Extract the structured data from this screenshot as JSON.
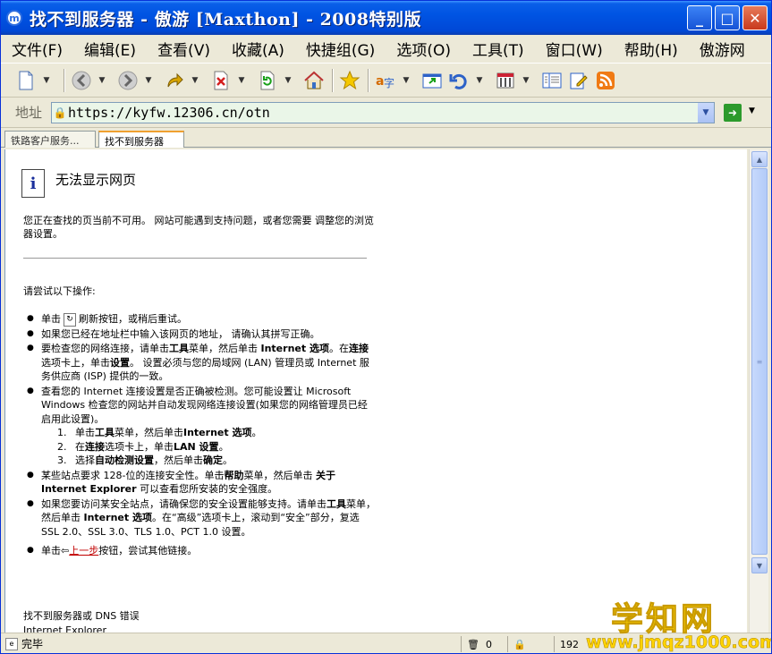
{
  "window": {
    "title": "找不到服务器 - 傲游 [Maxthon] - 2008特别版",
    "controls": {
      "minimize": "_",
      "maximize": "□",
      "close": "✕"
    }
  },
  "menu": [
    "文件(F)",
    "编辑(E)",
    "查看(V)",
    "收藏(A)",
    "快捷组(G)",
    "选项(O)",
    "工具(T)",
    "窗口(W)",
    "帮助(H)",
    "傲游网"
  ],
  "toolbar": {
    "icons": [
      "new-page-icon",
      "back-icon",
      "forward-icon",
      "up-icon",
      "stop-icon",
      "refresh-icon",
      "home-icon",
      "favorites-star-icon",
      "translate-icon",
      "window-icon",
      "undo-icon",
      "tools-icon",
      "sidebar-icon",
      "edit-icon",
      "rss-icon"
    ]
  },
  "address": {
    "label": "地址",
    "url": "https://kyfw.12306.cn/otn"
  },
  "tabs": [
    {
      "label": "铁路客户服务..."
    },
    {
      "label": "找不到服务器"
    }
  ],
  "page": {
    "heading": "无法显示网页",
    "description": "您正在查找的页当前不可用。 网站可能遇到支持问题，或者您需要 调整您的浏览器设置。",
    "try_label": "请尝试以下操作:",
    "step1_pre": "单击",
    "step1_post": "刷新按钮，或稍后重试。",
    "step2": "如果您已经在地址栏中输入该网页的地址， 请确认其拼写正确。",
    "step3": {
      "t1": "要检查您的网络连接，请单击",
      "b1": "工具",
      "t2": "菜单，然后单击 ",
      "b2": "Internet 选项",
      "t3": "。在",
      "b3": "连接",
      "t4": "选项卡上，单击",
      "b4": "设置",
      "t5": "。 设置必须与您的局域网 (LAN) 管理员或 Internet 服务供应商 (ISP) 提供的一致。"
    },
    "step4": "查看您的 Internet 连接设置是否正确被检测。您可能设置让 Microsoft Windows 检查您的网站并自动发现网络连接设置(如果您的网络管理员已经启用此设置)。",
    "sub1": {
      "n": "1.",
      "t1": "单击",
      "b1": "工具",
      "t2": "菜单，然后单击",
      "b2": "Internet 选项",
      "t3": "。"
    },
    "sub2": {
      "n": "2.",
      "t1": "在",
      "b1": "连接",
      "t2": "选项卡上，单击",
      "b2": "LAN 设置",
      "t3": "。"
    },
    "sub3": {
      "n": "3.",
      "t1": "选择",
      "b1": "自动检测设置",
      "t2": "，然后单击",
      "b2": "确定",
      "t3": "。"
    },
    "step5": {
      "t1": "某些站点要求 128-位的连接安全性。单击",
      "b1": "帮助",
      "t2": "菜单，然后单击 ",
      "b2": "关于 Internet Explorer",
      "t3": " 可以查看您所安装的安全强度。"
    },
    "step6": {
      "t1": "如果您要访问某安全站点，请确保您的安全设置能够支持。请单击",
      "b1": "工具",
      "t2": "菜单，然后单击 ",
      "b2": "Internet 选项",
      "t3": "。在“高级”选项卡上，滚动到“安全”部分，复选 SSL 2.0、SSL 3.0、TLS 1.0、PCT 1.0 设置。"
    },
    "step7": {
      "t1": "单击",
      "link": "上一步",
      "t2": "按钮，尝试其他链接。"
    },
    "footer1": "找不到服务器或 DNS 错误",
    "footer2": "Internet Explorer"
  },
  "status": {
    "text": "完毕",
    "count": "0",
    "extra": "192"
  },
  "watermark": {
    "title": "学知网",
    "url": "www.jmqz1000.com"
  }
}
